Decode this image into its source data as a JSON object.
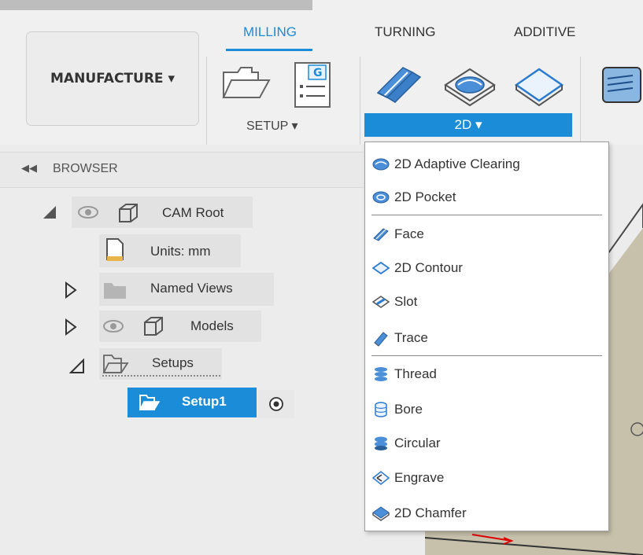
{
  "toolbar": {
    "workspace_label": "MANUFACTURE ▾",
    "tabs": [
      {
        "label": "MILLING",
        "active": true
      },
      {
        "label": "TURNING",
        "active": false
      },
      {
        "label": "ADDITIVE",
        "active": false
      }
    ],
    "setup_label": "SETUP ▾",
    "twod_label": "2D ▾",
    "accent_color": "#1a8cd8"
  },
  "browser": {
    "title": "BROWSER",
    "nodes": [
      {
        "label": "CAM Root"
      },
      {
        "label": "Units: mm"
      },
      {
        "label": "Named Views"
      },
      {
        "label": "Models"
      },
      {
        "label": "Setups"
      },
      {
        "label": "Setup1",
        "selected": true
      }
    ]
  },
  "menu": {
    "items": [
      {
        "label": "2D Adaptive Clearing",
        "icon": "adaptive-clearing-icon"
      },
      {
        "label": "2D Pocket",
        "icon": "pocket-icon"
      },
      {
        "label": "Face",
        "icon": "face-icon"
      },
      {
        "label": "2D Contour",
        "icon": "contour-icon"
      },
      {
        "label": "Slot",
        "icon": "slot-icon"
      },
      {
        "label": "Trace",
        "icon": "trace-icon"
      },
      {
        "label": "Thread",
        "icon": "thread-icon"
      },
      {
        "label": "Bore",
        "icon": "bore-icon"
      },
      {
        "label": "Circular",
        "icon": "circular-icon"
      },
      {
        "label": "Engrave",
        "icon": "engrave-icon"
      },
      {
        "label": "2D Chamfer",
        "icon": "chamfer-icon"
      }
    ]
  }
}
